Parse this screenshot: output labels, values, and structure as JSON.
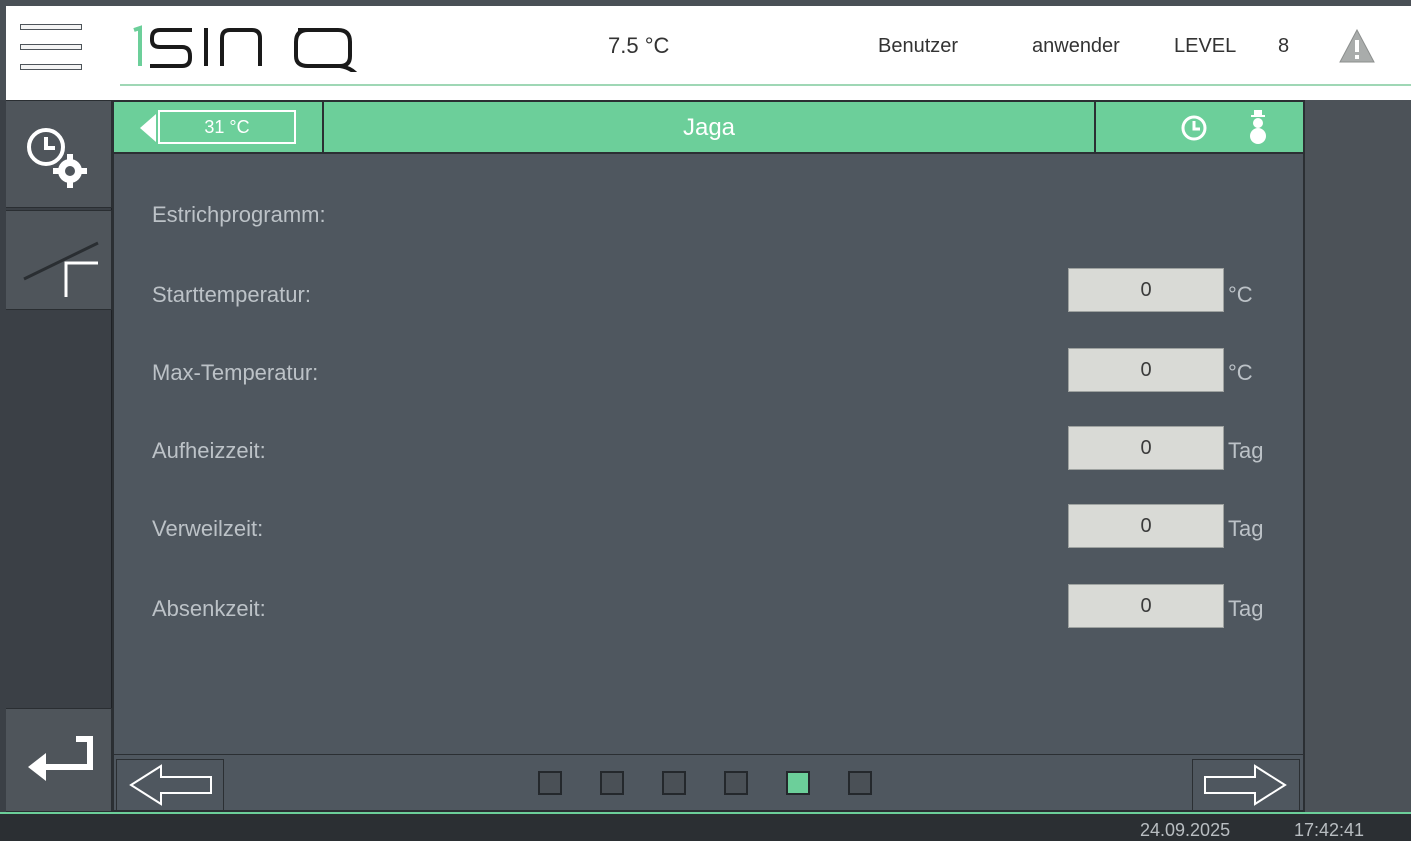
{
  "header": {
    "brand": "ISINQ",
    "outside_temperature": "7.5  °C",
    "user_label": "Benutzer",
    "user_name": "anwender",
    "level_label": "LEVEL",
    "level_value": "8",
    "icons": [
      "menu-icon",
      "warning-icon"
    ]
  },
  "sidebar": {
    "items": [
      {
        "name": "schedule-settings",
        "icon": "clock-gear-icon"
      },
      {
        "name": "screed-program",
        "icon": "screed-ramp-icon"
      },
      {
        "name": "back",
        "icon": "return-arrow-icon"
      }
    ]
  },
  "titlebar": {
    "temperature": "31  °C",
    "zone_name": "Jaga",
    "icons": [
      "clock-icon",
      "snowman-icon"
    ]
  },
  "form": {
    "heading": "Estrichprogramm:",
    "rows": [
      {
        "label": "Starttemperatur:",
        "value": "0",
        "unit": "°C"
      },
      {
        "label": "Max-Temperatur:",
        "value": "0",
        "unit": "°C"
      },
      {
        "label": "Aufheizzeit:",
        "value": "0",
        "unit": "Tag"
      },
      {
        "label": "Verweilzeit:",
        "value": "0",
        "unit": "Tag"
      },
      {
        "label": "Absenkzeit:",
        "value": "0",
        "unit": "Tag"
      }
    ]
  },
  "pagination": {
    "page_count": 6,
    "active_page": 5
  },
  "status": {
    "date": "24.09.2025",
    "time": "17:42:41"
  },
  "colors": {
    "accent": "#6ccf9a",
    "panel": "#4f575f",
    "background": "#2b2f33"
  }
}
